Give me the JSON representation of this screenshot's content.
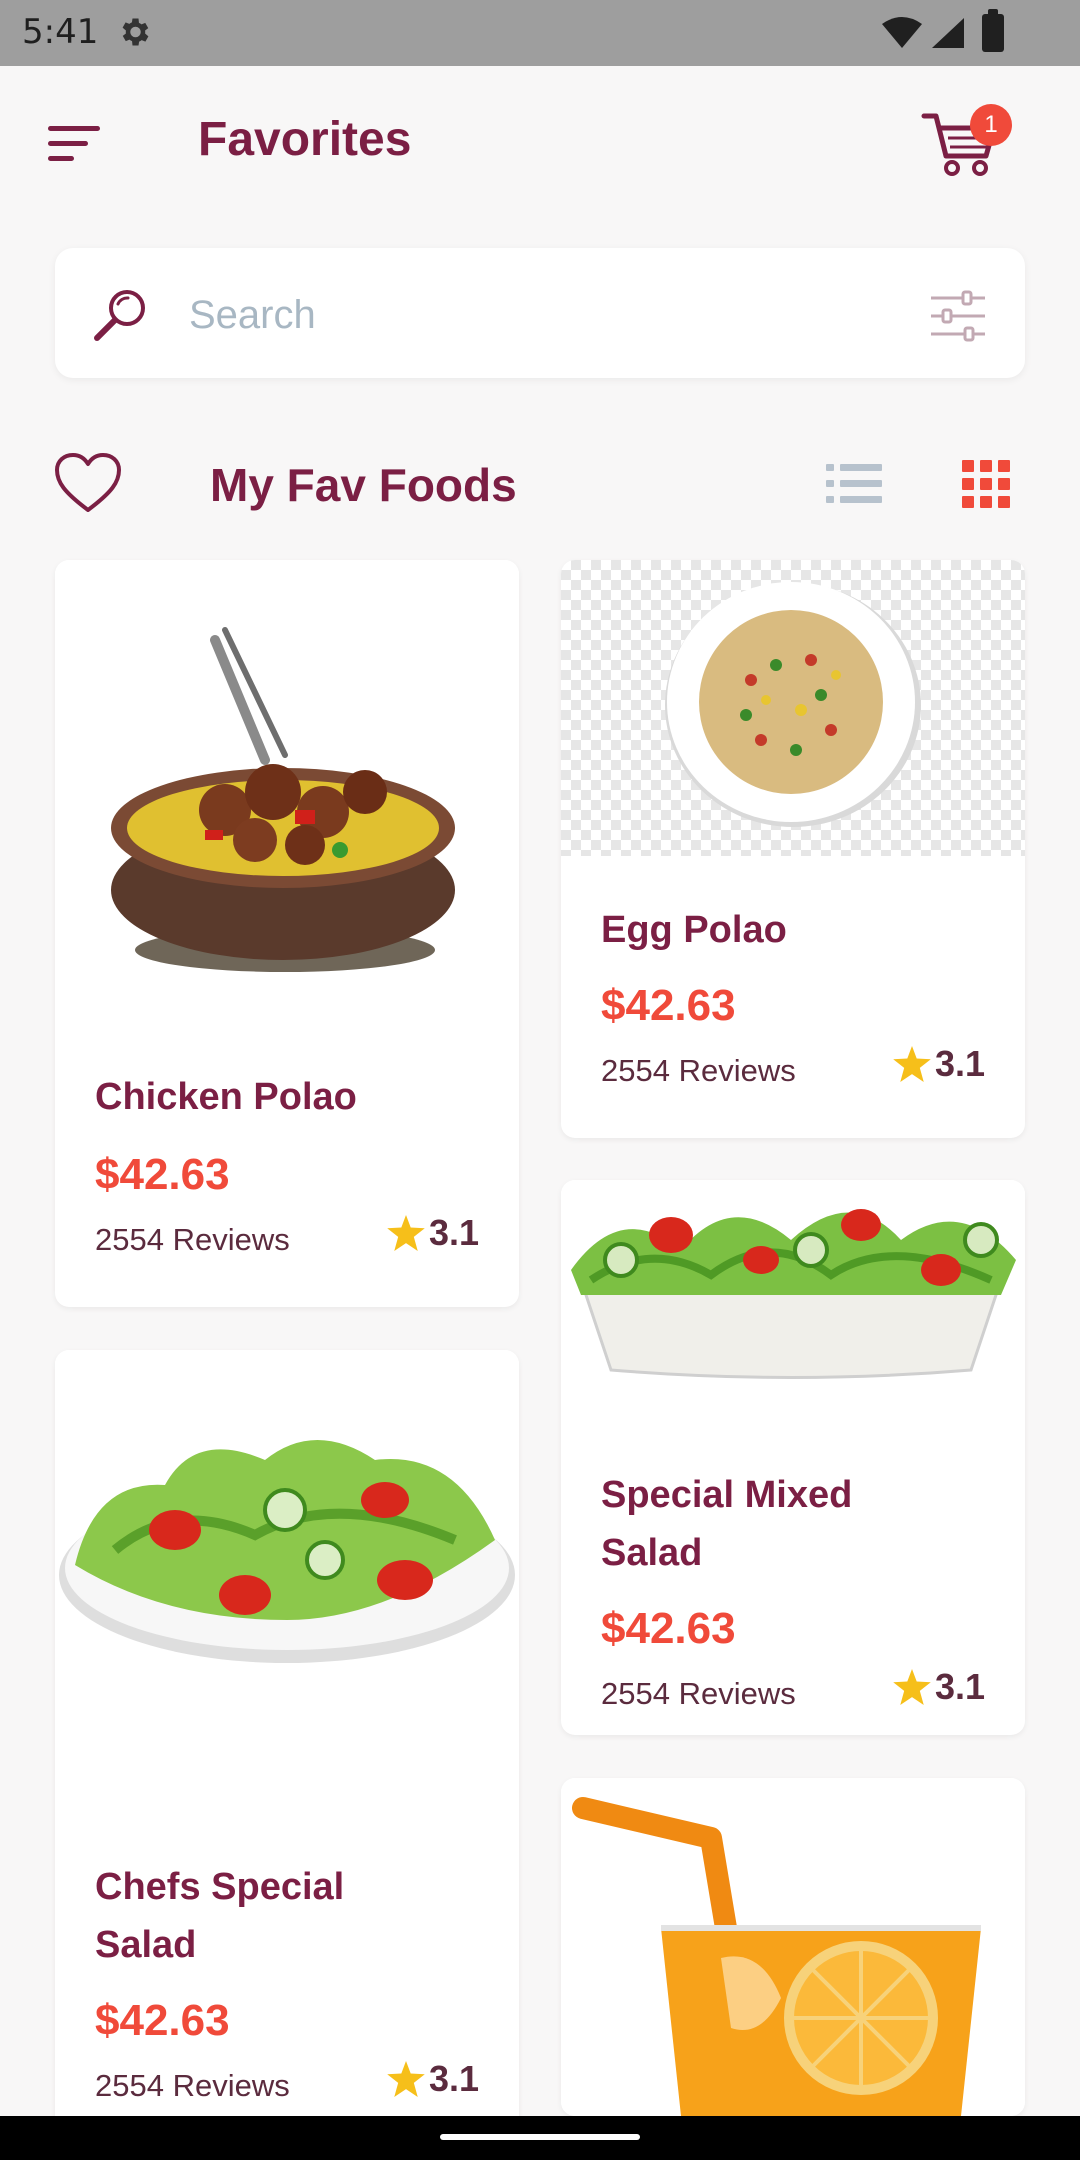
{
  "status_bar": {
    "time": "5:41"
  },
  "header": {
    "title": "Favorites",
    "cart_count": "1"
  },
  "search": {
    "placeholder": "Search"
  },
  "section": {
    "title": "My Fav Foods"
  },
  "colors": {
    "brand": "#7b1f44",
    "accent": "#f04a3a",
    "star": "#f6bf1a"
  },
  "items": [
    {
      "name": "Chicken Polao",
      "price": "$42.63",
      "reviews": "2554 Reviews",
      "rating": "3.1"
    },
    {
      "name": "Egg Polao",
      "price": "$42.63",
      "reviews": "2554 Reviews",
      "rating": "3.1"
    },
    {
      "name": "Special Mixed Salad",
      "price": "$42.63",
      "reviews": "2554 Reviews",
      "rating": "3.1"
    },
    {
      "name": "Chefs Special Salad",
      "price": "$42.63",
      "reviews": "2554 Reviews",
      "rating": "3.1"
    },
    {
      "name": "",
      "price": "",
      "reviews": "",
      "rating": ""
    }
  ]
}
